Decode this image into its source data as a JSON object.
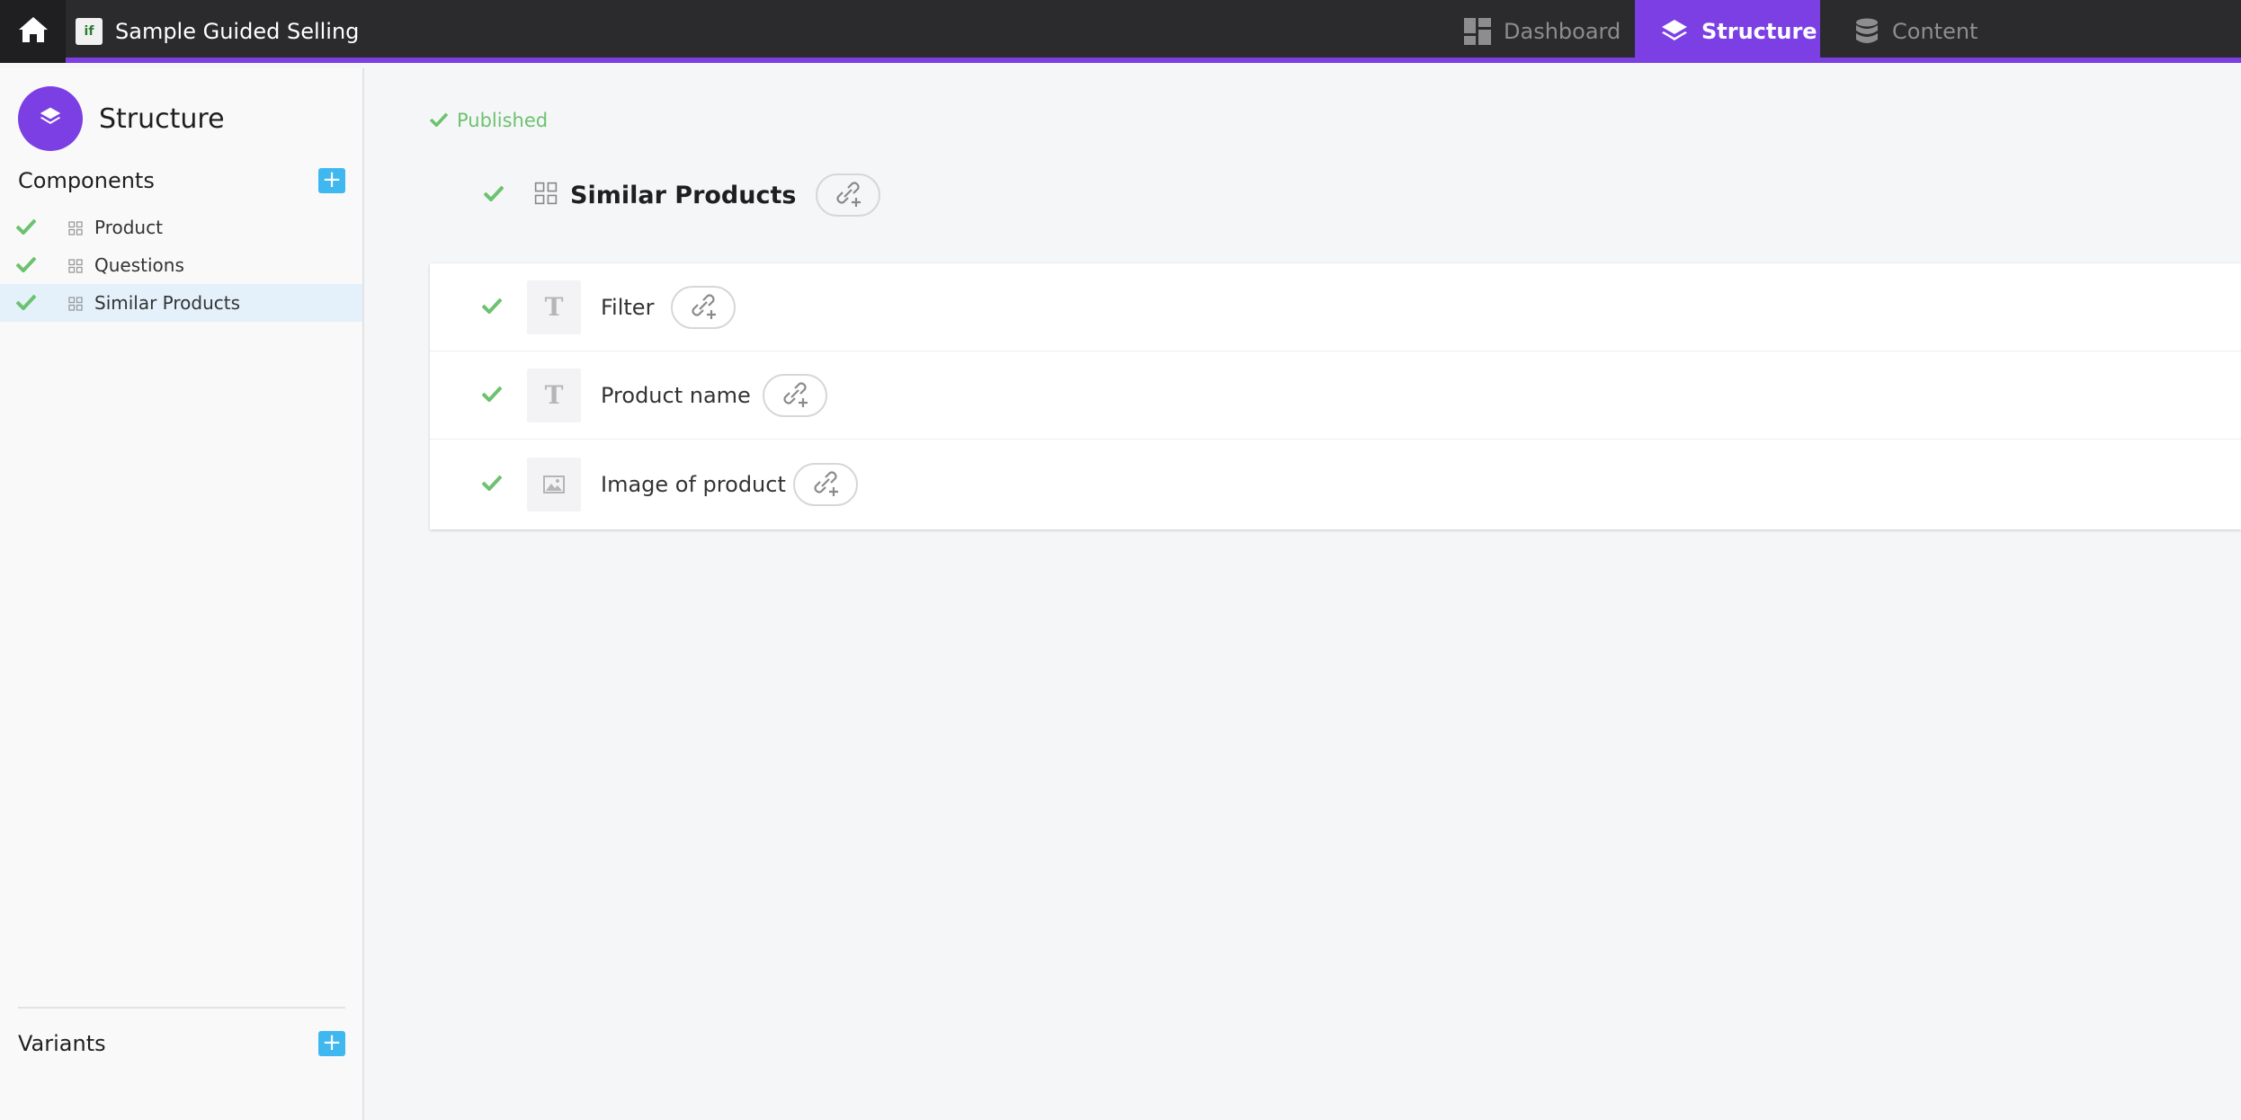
{
  "app": {
    "title": "Sample Guided Selling",
    "logo_text": "if"
  },
  "nav": {
    "tabs": [
      {
        "label": "Dashboard",
        "icon": "dashboard-icon",
        "active": false
      },
      {
        "label": "Structure",
        "icon": "layers-icon",
        "active": true
      },
      {
        "label": "Content",
        "icon": "database-icon",
        "active": false
      }
    ]
  },
  "sidebar": {
    "title": "Structure",
    "components_title": "Components",
    "components": [
      {
        "label": "Product",
        "status": "published",
        "selected": false
      },
      {
        "label": "Questions",
        "status": "published",
        "selected": false
      },
      {
        "label": "Similar Products",
        "status": "published",
        "selected": true
      }
    ],
    "variants_title": "Variants",
    "add_label": "+"
  },
  "main": {
    "status": "Published",
    "component_title": "Similar Products",
    "fields": [
      {
        "label": "Filter",
        "type": "text",
        "type_glyph": "T"
      },
      {
        "label": "Product name",
        "type": "text",
        "type_glyph": "T"
      },
      {
        "label": "Image of product",
        "type": "image",
        "type_glyph": ""
      }
    ]
  },
  "colors": {
    "accent": "#7b3fe4",
    "topbar": "#2b2b2d",
    "check": "#6cc26f",
    "add_button": "#3fb8f0"
  }
}
